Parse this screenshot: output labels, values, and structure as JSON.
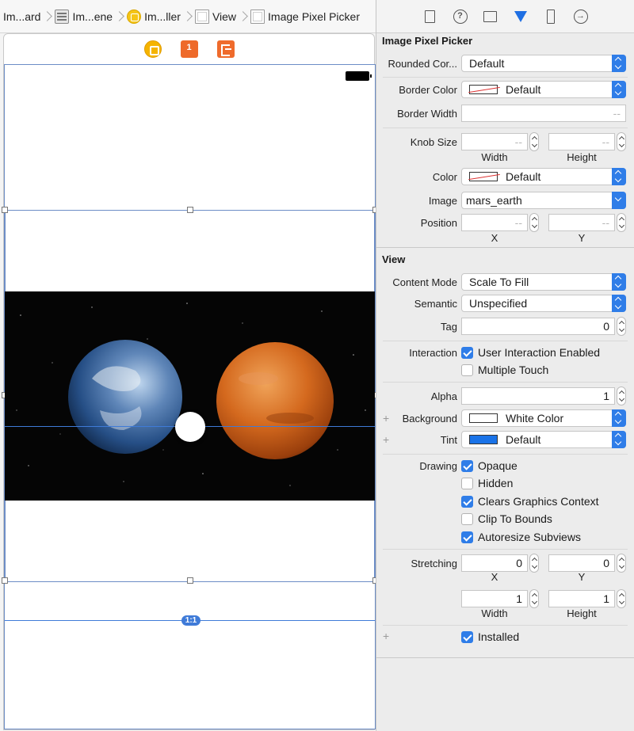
{
  "breadcrumb": [
    "Im...ard",
    "Im...ene",
    "Im...ller",
    "View",
    "Image Pixel Picker"
  ],
  "canvas": {
    "ratio_badge": "1:1"
  },
  "inspector": {
    "picker_section": {
      "title": "Image Pixel Picker",
      "rounded_corner": {
        "label": "Rounded Cor...",
        "value": "Default"
      },
      "border_color": {
        "label": "Border Color",
        "value": "Default"
      },
      "border_width": {
        "label": "Border Width",
        "value": "--"
      },
      "knob_size": {
        "label": "Knob Size",
        "width": "--",
        "height": "--",
        "width_label": "Width",
        "height_label": "Height"
      },
      "color": {
        "label": "Color",
        "value": "Default"
      },
      "image": {
        "label": "Image",
        "value": "mars_earth"
      },
      "position": {
        "label": "Position",
        "x": "--",
        "y": "--",
        "x_label": "X",
        "y_label": "Y"
      }
    },
    "view_section": {
      "title": "View",
      "content_mode": {
        "label": "Content Mode",
        "value": "Scale To Fill"
      },
      "semantic": {
        "label": "Semantic",
        "value": "Unspecified"
      },
      "tag": {
        "label": "Tag",
        "value": "0"
      },
      "interaction": {
        "label": "Interaction",
        "user_interaction": "User Interaction Enabled",
        "multiple_touch": "Multiple Touch"
      },
      "alpha": {
        "label": "Alpha",
        "value": "1"
      },
      "background": {
        "label": "Background",
        "value": "White Color"
      },
      "tint": {
        "label": "Tint",
        "value": "Default"
      },
      "drawing": {
        "label": "Drawing",
        "opaque": "Opaque",
        "hidden": "Hidden",
        "clears": "Clears Graphics Context",
        "clip": "Clip To Bounds",
        "autoresize": "Autoresize Subviews"
      },
      "stretching": {
        "label": "Stretching",
        "x": "0",
        "y": "0",
        "x_label": "X",
        "y_label": "Y",
        "width": "1",
        "height": "1",
        "width_label": "Width",
        "height_label": "Height"
      },
      "installed": "Installed"
    }
  }
}
